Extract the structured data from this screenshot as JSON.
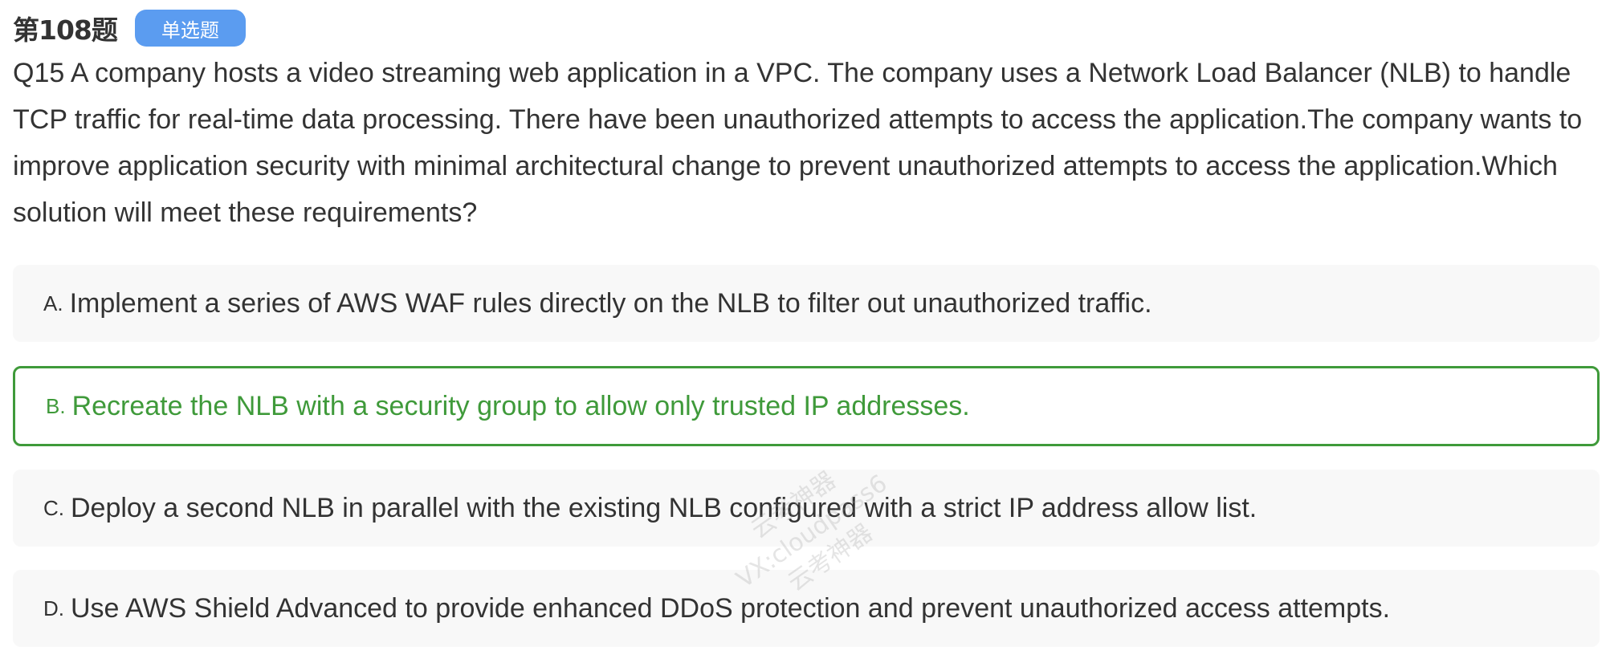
{
  "header": {
    "question_number": "第108题",
    "type_badge": "单选题"
  },
  "question": {
    "text": "Q15 A company hosts a video streaming web application in a VPC. The company uses a Network Load Balancer (NLB) to handle TCP traffic for real-time data processing. There have been unauthorized attempts to access the application.The company wants to improve application security with minimal architectural change to prevent unauthorized attempts to access the application.Which solution will meet these requirements?"
  },
  "options": [
    {
      "letter": "A.",
      "text": "Implement a series of AWS WAF rules directly on the NLB to filter out unauthorized traffic.",
      "state": "default"
    },
    {
      "letter": "B.",
      "text": "Recreate the NLB with a security group to allow only trusted IP addresses.",
      "state": "correct"
    },
    {
      "letter": "C.",
      "text": "Deploy a second NLB in parallel with the existing NLB configured with a strict IP address allow list.",
      "state": "default"
    },
    {
      "letter": "D.",
      "text": "Use AWS Shield Advanced to provide enhanced DDoS protection and prevent unauthorized access attempts.",
      "state": "default"
    }
  ],
  "watermark": {
    "line1": "云考神器",
    "line2": "VX:cloudpass6",
    "line3": "云考神器"
  },
  "colors": {
    "badge_background": "#5b9cf0",
    "correct_accent": "#3f9a3a",
    "option_background": "#f8f8f8",
    "text": "#333333"
  }
}
